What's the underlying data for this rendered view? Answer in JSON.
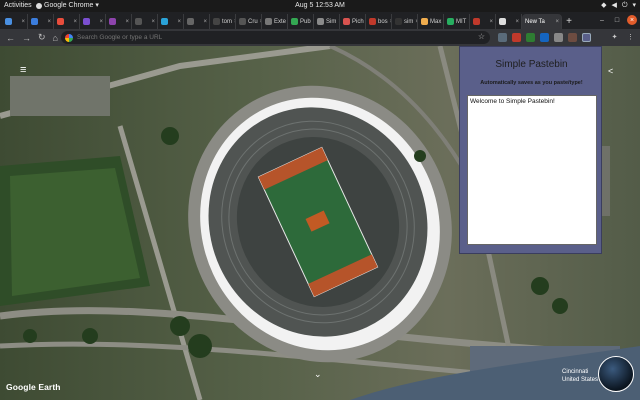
{
  "system_bar": {
    "activities": "Activities",
    "app_name": "Google Chrome",
    "clock": "Aug 5  12:53 AM"
  },
  "tabs": [
    {
      "label": "",
      "color": "#4a90e2"
    },
    {
      "label": "",
      "color": "#3b7ddd"
    },
    {
      "label": "",
      "color": "#e84d3c"
    },
    {
      "label": "",
      "color": "#7b4fd1"
    },
    {
      "label": "",
      "color": "#8e44ad"
    },
    {
      "label": "",
      "color": "#555555"
    },
    {
      "label": "",
      "color": "#2aa3d8"
    },
    {
      "label": "",
      "color": "#666666"
    },
    {
      "label": "tom",
      "color": "#444444"
    },
    {
      "label": "Cru",
      "color": "#555555"
    },
    {
      "label": "Exte",
      "color": "#777777"
    },
    {
      "label": "Pub",
      "color": "#34a853"
    },
    {
      "label": "Sim",
      "color": "#8a8a8a"
    },
    {
      "label": "Pich",
      "color": "#d9534f"
    },
    {
      "label": "bos",
      "color": "#c0392b"
    },
    {
      "label": "sim",
      "color": "#333333"
    },
    {
      "label": "Max",
      "color": "#f0ad4e"
    },
    {
      "label": "MIT",
      "color": "#27ae60"
    },
    {
      "label": "",
      "color": "#c0392b"
    },
    {
      "label": "",
      "color": "#dddddd"
    }
  ],
  "active_tab": {
    "label": "New Ta"
  },
  "omnibox": {
    "placeholder": "Search Google or type a URL"
  },
  "map": {
    "brand": "Google Earth",
    "place_line1": "Cincinnati",
    "place_line2": "United States"
  },
  "popup": {
    "title": "Simple Pastebin",
    "subtitle": "Automatically saves as you paste/type!",
    "content": "Welcome to Simple Pastebin!"
  }
}
